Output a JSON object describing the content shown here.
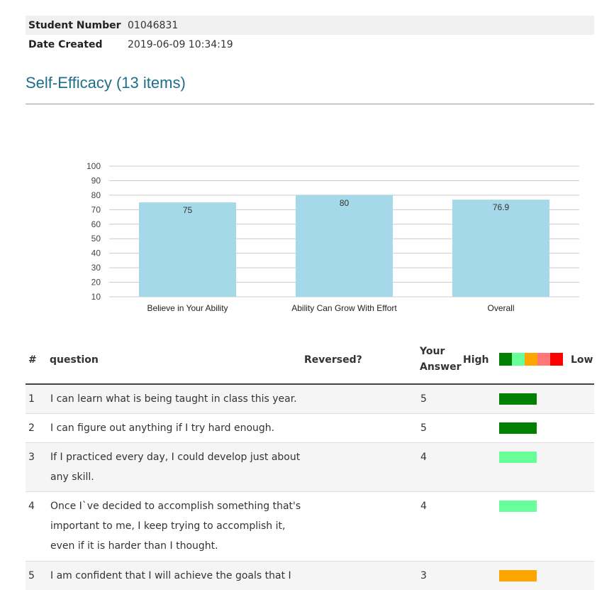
{
  "student": {
    "number_label": "Student Number",
    "number_value": "01046831",
    "date_label": "Date Created",
    "date_value": "2019-06-09 10:34:19"
  },
  "section": {
    "title": "Self-Efficacy (13 items)"
  },
  "chart_data": {
    "type": "bar",
    "categories": [
      "Believe in Your Ability",
      "Ability Can Grow With Effort",
      "Overall"
    ],
    "values": [
      75,
      80,
      76.9
    ],
    "value_labels": [
      "75",
      "80",
      "76.9"
    ],
    "ylim": [
      10,
      100
    ],
    "yticks": [
      "100",
      "90",
      "80",
      "70",
      "60",
      "50",
      "40",
      "30",
      "20",
      "10"
    ],
    "bar_color": "#a5d8e8",
    "grid": true
  },
  "table": {
    "headers": {
      "num": "#",
      "question": "question",
      "reversed": "Reversed?",
      "answer_line1": "Your",
      "answer_line2": "Answer",
      "high": "High",
      "low": "Low"
    },
    "legend_colors": [
      "#008000",
      "#66ff99",
      "#ffa500",
      "#ff7777",
      "#ff0000"
    ],
    "rows": [
      {
        "num": "1",
        "text": "I can learn what is being taught in class this year.",
        "answer": "5",
        "color": "#008000"
      },
      {
        "num": "2",
        "text": "I can figure out anything if I try hard enough.",
        "answer": "5",
        "color": "#008000"
      },
      {
        "num": "3",
        "text": "If I practiced every day, I could develop just about any skill.",
        "answer": "4",
        "color": "#66ff99"
      },
      {
        "num": "4",
        "text": "Once I`ve decided to accomplish something that's important to me, I keep trying to accomplish it, even if it is harder than I thought.",
        "answer": "4",
        "color": "#66ff99"
      },
      {
        "num": "5",
        "text": "I am confident that I will achieve the goals that I set for myself.",
        "answer": "3",
        "color": "#ffa500"
      }
    ]
  }
}
